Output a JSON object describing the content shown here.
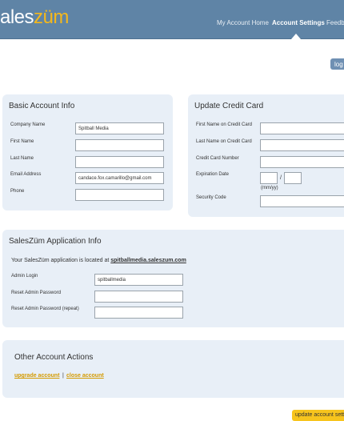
{
  "header": {
    "logo_left": "ales",
    "logo_right": "züm",
    "nav": [
      "My Account Home",
      "Account Settings",
      "Feedb"
    ]
  },
  "logout_label": "log",
  "basic_info": {
    "title": "Basic Account Info",
    "company_label": "Company Name",
    "company_value": "Spitball Media",
    "first_label": "First Name",
    "last_label": "Last Name",
    "email_label": "Email Address",
    "email_value": "candace.fox.camarillo@gmail.com",
    "phone_label": "Phone"
  },
  "credit_card": {
    "title": "Update Credit Card",
    "first_label": "First Name on Credit Card",
    "last_label": "Last Name on Credit Card",
    "number_label": "Credit Card Number",
    "expiration_label": "Expiration Date",
    "expiration_hint": "(mm/yy)",
    "expiration_sep": "/",
    "security_label": "Security Code"
  },
  "app_info": {
    "title": "SalesZüm Application Info",
    "location_prefix": "Your SalesZüm application is located at",
    "location_url": "spitballmedia.saleszum.com",
    "admin_label": "Admin Login",
    "admin_value": "spitballmedia",
    "reset_label": "Reset Admin Password",
    "reset_repeat_label": "Reset Admin Password (repeat)"
  },
  "other_actions": {
    "title": "Other Account Actions",
    "upgrade": "upgrade account",
    "separator": "|",
    "close": "close account"
  },
  "update_button": "update account settings",
  "colors": {
    "header": "#5f84a6",
    "accent": "#f4b81c",
    "panel": "#e8eff7",
    "button": "#f7c41d"
  }
}
